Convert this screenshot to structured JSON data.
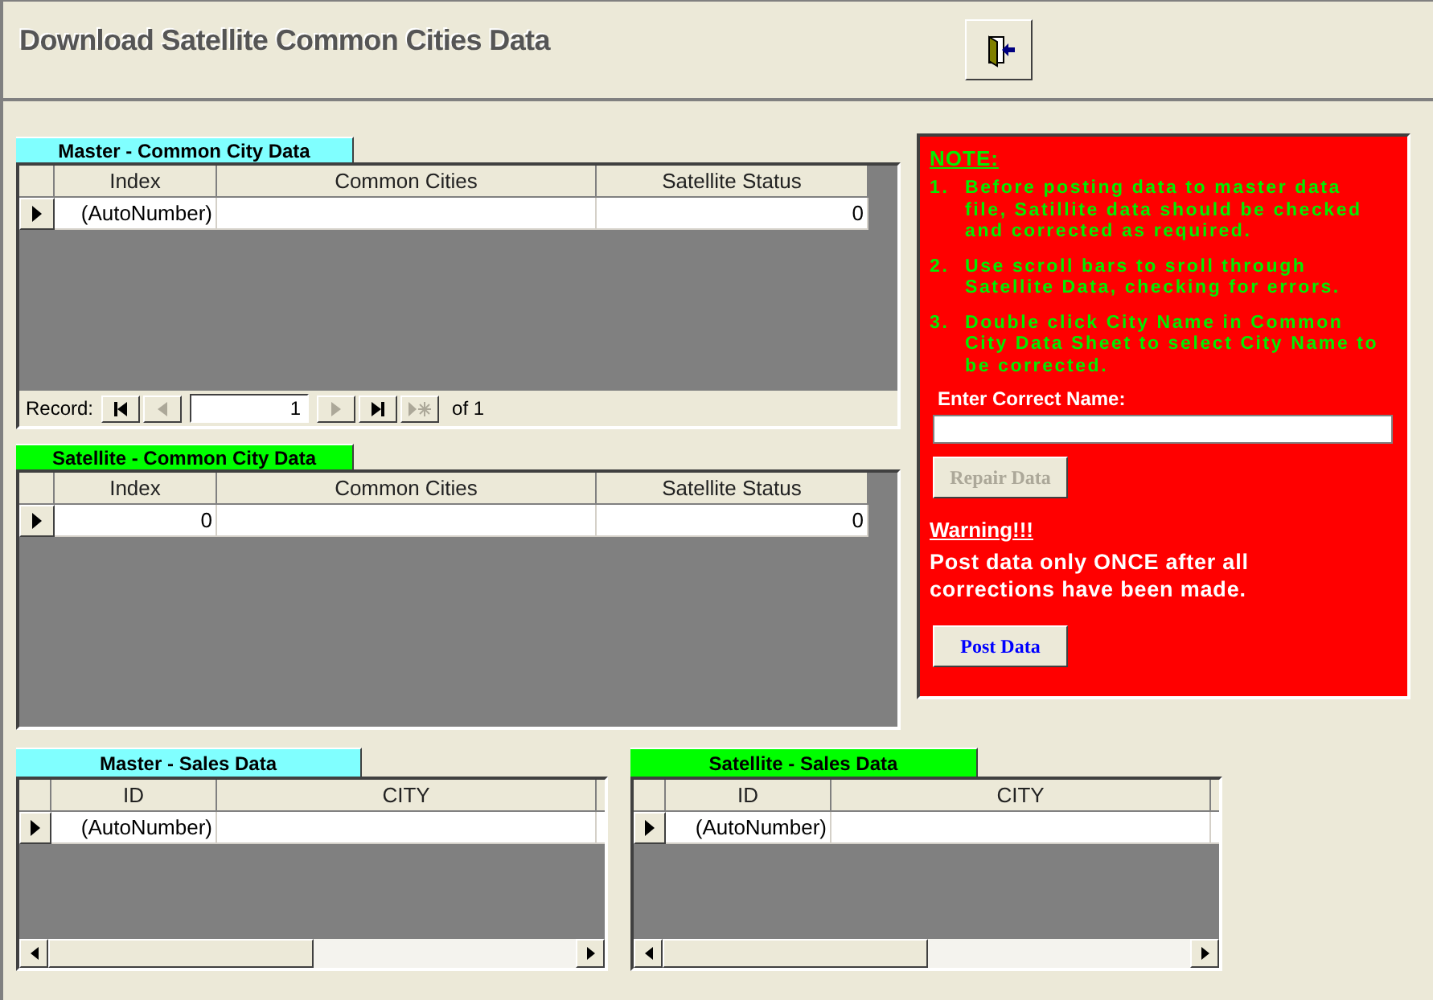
{
  "form": {
    "title": "Download Satellite Common Cities Data"
  },
  "city_grids": [
    {
      "label": "Master - Common City Data",
      "color": "#80ffff",
      "columns": [
        "Index",
        "Common Cities",
        "Satellite Status"
      ],
      "rows": [
        {
          "current": true,
          "index": "(AutoNumber)",
          "status": "0"
        }
      ],
      "navigator": {
        "label": "Record:",
        "value": "1",
        "total": "of 1"
      }
    },
    {
      "label": "Satellite - Common City Data",
      "color": "#00ff00",
      "columns": [
        "Index",
        "Common Cities",
        "Satellite Status"
      ],
      "rows": [
        {
          "current": true,
          "index": "0",
          "status": "0"
        }
      ]
    }
  ],
  "note": {
    "heading": "NOTE:",
    "items": [
      {
        "number": "1.",
        "text": "Before posting data to master data file, Satillite data should be checked and corrected as required."
      },
      {
        "number": "2.",
        "text": "Use scroll bars to sroll through Satellite Data, checking for errors."
      },
      {
        "number": "3.",
        "text": "Double click City Name in Common City Data Sheet to select City Name to be corrected."
      }
    ],
    "field_label": "Enter Correct Name:",
    "repair_button": {
      "label": "Repair Data",
      "disabled": true
    },
    "warning_heading": "Warning!!!",
    "warning_text": "Post data only ONCE after all corrections have been made.",
    "post_button": {
      "label": "Post Data",
      "disabled": false
    }
  },
  "sales_grids": [
    {
      "label": "Master - Sales Data",
      "color": "#80ffff",
      "columns": [
        "ID",
        "CITY"
      ],
      "rows": [
        {
          "current": true,
          "id": "(AutoNumber)"
        }
      ]
    },
    {
      "label": "Satellite - Sales Data",
      "color": "#00ff00",
      "columns": [
        "ID",
        "CITY"
      ],
      "rows": [
        {
          "current": true,
          "id": "(AutoNumber)"
        }
      ]
    }
  ]
}
